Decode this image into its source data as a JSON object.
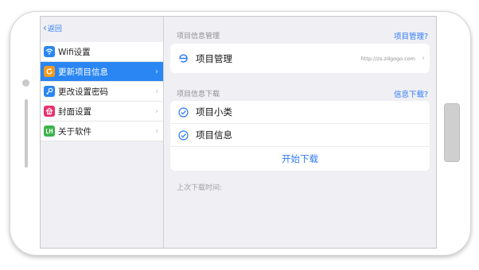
{
  "sidebar": {
    "back_label": "返回",
    "items": [
      {
        "label": "Wifi设置",
        "icon": "wifi-icon",
        "icon_color": "#2a86f3",
        "selected": false
      },
      {
        "label": "更新项目信息",
        "icon": "refresh-icon",
        "icon_color": "#f39a1e",
        "selected": true
      },
      {
        "label": "更改设置密码",
        "icon": "key-icon",
        "icon_color": "#2a86f3",
        "selected": false
      },
      {
        "label": "封面设置",
        "icon": "home-icon",
        "icon_color": "#e8336d",
        "selected": false
      },
      {
        "label": "关于软件",
        "icon": "app-icon",
        "icon_color": "#3bb54a",
        "selected": false
      }
    ]
  },
  "project_section": {
    "header": "项目信息管理",
    "link": "项目管理?",
    "row": {
      "label": "项目管理",
      "value": "http://zs.zdgogo.com",
      "icon": "e-icon"
    }
  },
  "download_section": {
    "header": "项目信息下载",
    "link": "信息下载?",
    "options": [
      {
        "label": "项目小类",
        "icon": "check-circle-icon"
      },
      {
        "label": "项目信息",
        "icon": "check-circle-icon"
      }
    ],
    "action": "开始下载"
  },
  "last_download_label": "上次下载时间:",
  "colors": {
    "accent": "#2f7cf6",
    "selected_bg": "#2a86f3",
    "background": "#efeff4"
  }
}
